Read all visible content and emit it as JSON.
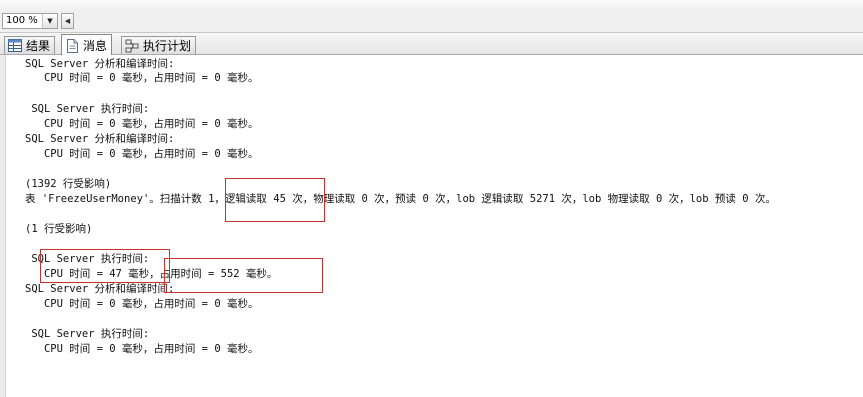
{
  "toolbar": {
    "zoom_value": "100 %"
  },
  "tabs": [
    {
      "label": "结果",
      "icon": "grid-icon",
      "active": false
    },
    {
      "label": "消息",
      "icon": "document-icon",
      "active": true
    },
    {
      "label": "执行计划",
      "icon": "execution-plan-icon",
      "active": false
    }
  ],
  "messages": {
    "line01": "SQL Server 分析和编译时间:",
    "line02": "   CPU 时间 = 0 毫秒，占用时间 = 0 毫秒。",
    "line03": " SQL Server 执行时间:",
    "line04": "   CPU 时间 = 0 毫秒，占用时间 = 0 毫秒。",
    "line05": "SQL Server 分析和编译时间:",
    "line06": "   CPU 时间 = 0 毫秒，占用时间 = 0 毫秒。",
    "line07": "(1392 行受影响)",
    "line08": "表 'FreezeUserMoney'。扫描计数 1，逻辑读取 45 次，物理读取 0 次，预读 0 次，lob 逻辑读取 5271 次，lob 物理读取 0 次，lob 预读 0 次。",
    "line09": "(1 行受影响)",
    "line10": " SQL Server 执行时间:",
    "line11": "   CPU 时间 = 47 毫秒，占用时间 = 552 毫秒。",
    "line12": "SQL Server 分析和编译时间:",
    "line13": "   CPU 时间 = 0 毫秒，占用时间 = 0 毫秒。",
    "line14": " SQL Server 执行时间:",
    "line15": "   CPU 时间 = 0 毫秒，占用时间 = 0 毫秒。"
  },
  "highlight_color": "#c8322c"
}
